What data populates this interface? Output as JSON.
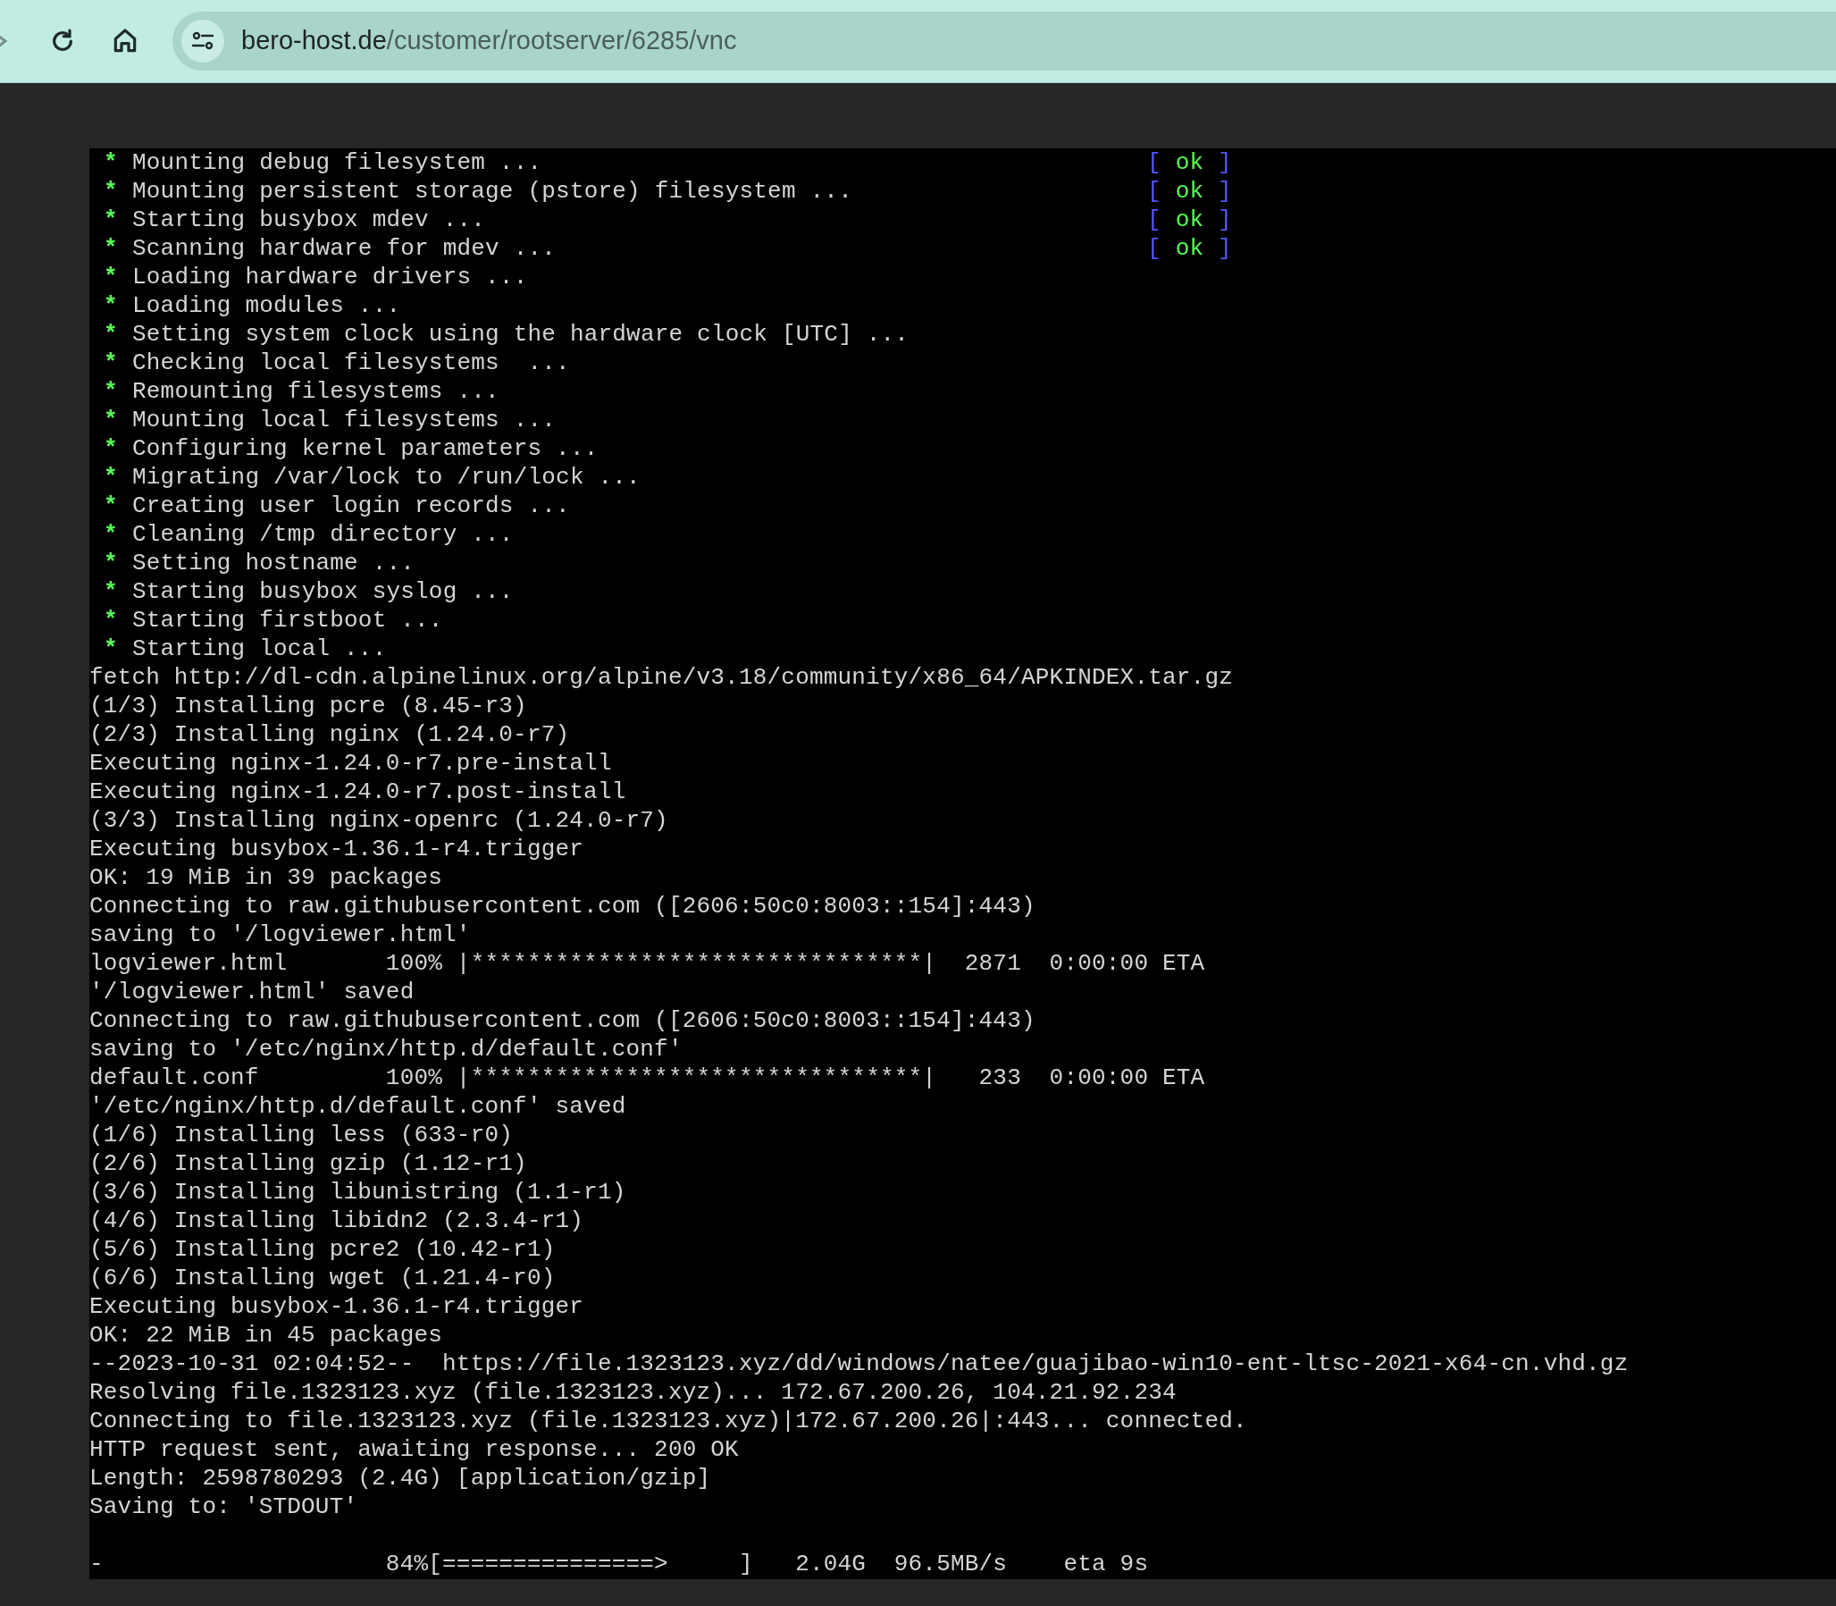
{
  "browser": {
    "url": {
      "host": "bero-host.de",
      "path": "/customer/rootserver/6285/vnc"
    }
  },
  "console": {
    "bullet": "*",
    "lines": [
      {
        "kind": "service",
        "text": "Mounting debug filesystem ...",
        "status": {
          "open": "[",
          "label": "ok",
          "close": "]"
        }
      },
      {
        "kind": "service",
        "text": "Mounting persistent storage (pstore) filesystem ...",
        "status": {
          "open": "[",
          "label": "ok",
          "close": "]"
        }
      },
      {
        "kind": "service",
        "text": "Starting busybox mdev ...",
        "status": {
          "open": "[",
          "label": "ok",
          "close": "]"
        }
      },
      {
        "kind": "service",
        "text": "Scanning hardware for mdev ...",
        "status": {
          "open": "[",
          "label": "ok",
          "close": "]"
        }
      },
      {
        "kind": "service",
        "text": "Loading hardware drivers ..."
      },
      {
        "kind": "service",
        "text": "Loading modules ..."
      },
      {
        "kind": "service",
        "text": "Setting system clock using the hardware clock [UTC] ..."
      },
      {
        "kind": "service",
        "text": "Checking local filesystems  ..."
      },
      {
        "kind": "service",
        "text": "Remounting filesystems ..."
      },
      {
        "kind": "service",
        "text": "Mounting local filesystems ..."
      },
      {
        "kind": "service",
        "text": "Configuring kernel parameters ..."
      },
      {
        "kind": "service",
        "text": "Migrating /var/lock to /run/lock ..."
      },
      {
        "kind": "service",
        "text": "Creating user login records ..."
      },
      {
        "kind": "service",
        "text": "Cleaning /tmp directory ..."
      },
      {
        "kind": "service",
        "text": "Setting hostname ..."
      },
      {
        "kind": "service",
        "text": "Starting busybox syslog ..."
      },
      {
        "kind": "service",
        "text": "Starting firstboot ..."
      },
      {
        "kind": "service",
        "text": "Starting local ..."
      },
      {
        "kind": "plain",
        "text": "fetch http://dl-cdn.alpinelinux.org/alpine/v3.18/community/x86_64/APKINDEX.tar.gz"
      },
      {
        "kind": "plain",
        "text": "(1/3) Installing pcre (8.45-r3)"
      },
      {
        "kind": "plain",
        "text": "(2/3) Installing nginx (1.24.0-r7)"
      },
      {
        "kind": "plain",
        "text": "Executing nginx-1.24.0-r7.pre-install"
      },
      {
        "kind": "plain",
        "text": "Executing nginx-1.24.0-r7.post-install"
      },
      {
        "kind": "plain",
        "text": "(3/3) Installing nginx-openrc (1.24.0-r7)"
      },
      {
        "kind": "plain",
        "text": "Executing busybox-1.36.1-r4.trigger"
      },
      {
        "kind": "plain",
        "text": "OK: 19 MiB in 39 packages"
      },
      {
        "kind": "plain",
        "text": "Connecting to raw.githubusercontent.com ([2606:50c0:8003::154]:443)"
      },
      {
        "kind": "plain",
        "text": "saving to '/logviewer.html'"
      },
      {
        "kind": "plain",
        "text": "logviewer.html       100% |********************************|  2871  0:00:00 ETA"
      },
      {
        "kind": "plain",
        "text": "'/logviewer.html' saved"
      },
      {
        "kind": "plain",
        "text": "Connecting to raw.githubusercontent.com ([2606:50c0:8003::154]:443)"
      },
      {
        "kind": "plain",
        "text": "saving to '/etc/nginx/http.d/default.conf'"
      },
      {
        "kind": "plain",
        "text": "default.conf         100% |********************************|   233  0:00:00 ETA"
      },
      {
        "kind": "plain",
        "text": "'/etc/nginx/http.d/default.conf' saved"
      },
      {
        "kind": "plain",
        "text": "(1/6) Installing less (633-r0)"
      },
      {
        "kind": "plain",
        "text": "(2/6) Installing gzip (1.12-r1)"
      },
      {
        "kind": "plain",
        "text": "(3/6) Installing libunistring (1.1-r1)"
      },
      {
        "kind": "plain",
        "text": "(4/6) Installing libidn2 (2.3.4-r1)"
      },
      {
        "kind": "plain",
        "text": "(5/6) Installing pcre2 (10.42-r1)"
      },
      {
        "kind": "plain",
        "text": "(6/6) Installing wget (1.21.4-r0)"
      },
      {
        "kind": "plain",
        "text": "Executing busybox-1.36.1-r4.trigger"
      },
      {
        "kind": "plain",
        "text": "OK: 22 MiB in 45 packages"
      },
      {
        "kind": "plain",
        "text": "--2023-10-31 02:04:52--  https://file.1323123.xyz/dd/windows/natee/guajibao-win10-ent-ltsc-2021-x64-cn.vhd.gz"
      },
      {
        "kind": "plain",
        "text": "Resolving file.1323123.xyz (file.1323123.xyz)... 172.67.200.26, 104.21.92.234"
      },
      {
        "kind": "plain",
        "text": "Connecting to file.1323123.xyz (file.1323123.xyz)|172.67.200.26|:443... connected."
      },
      {
        "kind": "plain",
        "text": "HTTP request sent, awaiting response... 200 OK"
      },
      {
        "kind": "plain",
        "text": "Length: 2598780293 (2.4G) [application/gzip]"
      },
      {
        "kind": "plain",
        "text": "Saving to: 'STDOUT'"
      },
      {
        "kind": "blank"
      },
      {
        "kind": "plain",
        "text": "-                    84%[===============>     ]   2.04G  96.5MB/s    eta 9s"
      }
    ]
  }
}
